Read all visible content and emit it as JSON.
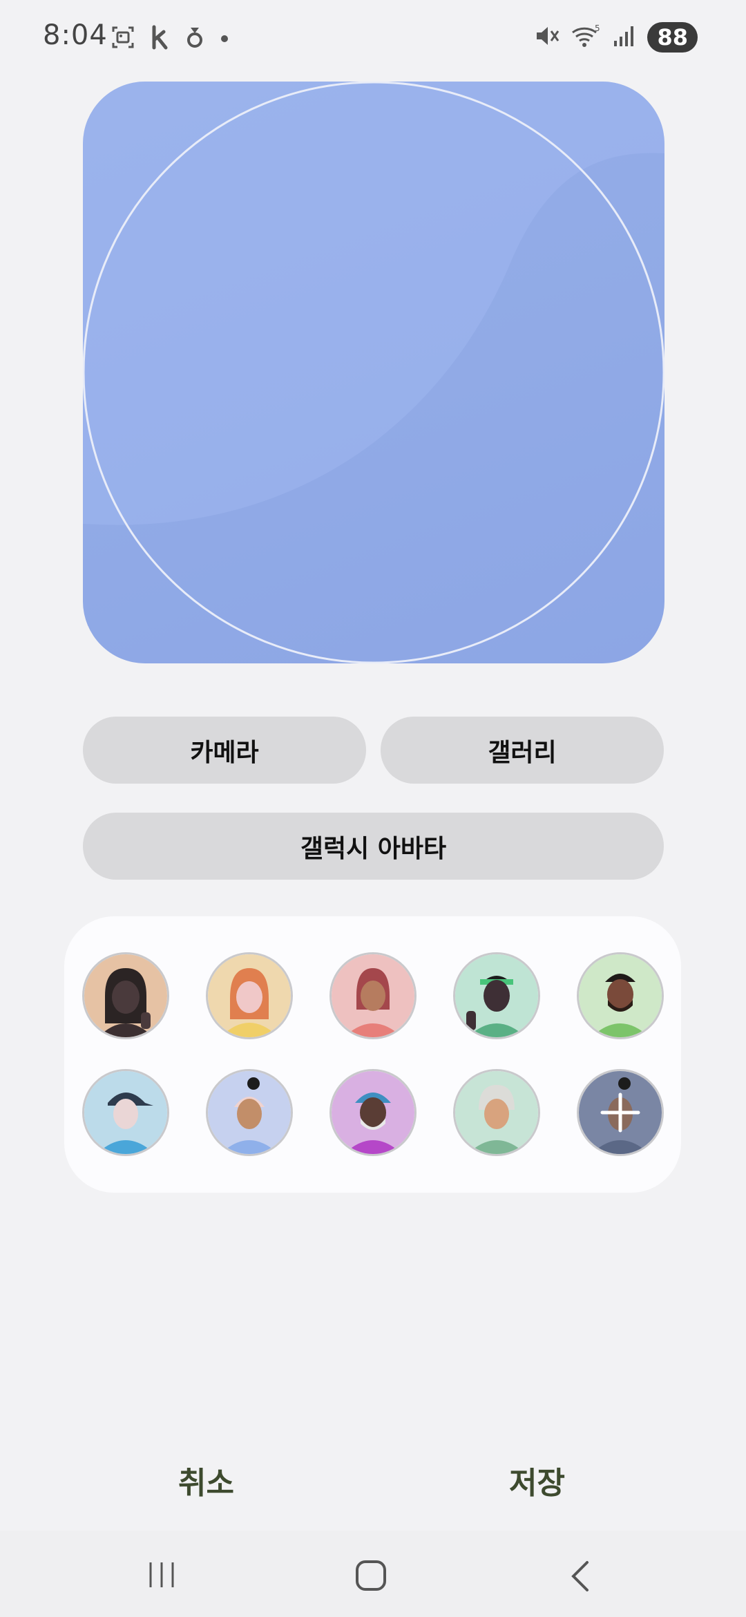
{
  "status_bar": {
    "time": "8:04",
    "left_icons": [
      "screenshot-icon",
      "k-app-icon",
      "kakao-icon",
      "notification-dot-icon"
    ],
    "right_icons": [
      "mute-icon",
      "wifi-icon",
      "signal-icon"
    ],
    "battery": "88"
  },
  "preview": {
    "background_color": "#97afe9"
  },
  "buttons": {
    "camera": "카메라",
    "gallery": "갤러리",
    "galaxy_avatar": "갤럭시 아바타"
  },
  "avatars": [
    {
      "name": "avatar-1",
      "bg": "#e6c2a4"
    },
    {
      "name": "avatar-2",
      "bg": "#efd8ae"
    },
    {
      "name": "avatar-3",
      "bg": "#eec1c0"
    },
    {
      "name": "avatar-4",
      "bg": "#bfe4d4"
    },
    {
      "name": "avatar-5",
      "bg": "#cfe8c8"
    },
    {
      "name": "avatar-6",
      "bg": "#bcdbea"
    },
    {
      "name": "avatar-7",
      "bg": "#c6d1ef"
    },
    {
      "name": "avatar-8",
      "bg": "#d9b0e2"
    },
    {
      "name": "avatar-9",
      "bg": "#c7e4d6"
    },
    {
      "name": "avatar-10",
      "bg": "#7a86a4"
    }
  ],
  "actions": {
    "cancel": "취소",
    "save": "저장"
  },
  "nav": {
    "icons": [
      "recent-apps-icon",
      "home-icon",
      "back-icon"
    ]
  }
}
